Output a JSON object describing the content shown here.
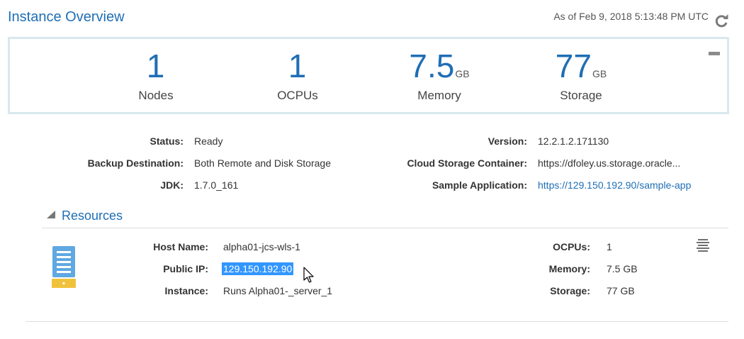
{
  "header": {
    "title": "Instance Overview",
    "as_of": "As of Feb 9, 2018 5:13:48 PM UTC",
    "refresh_icon": "refresh-icon"
  },
  "summary": {
    "nodes": {
      "value": "1",
      "unit": "",
      "label": "Nodes"
    },
    "ocpus": {
      "value": "1",
      "unit": "",
      "label": "OCPUs"
    },
    "memory": {
      "value": "7.5",
      "unit": "GB",
      "label": "Memory"
    },
    "storage": {
      "value": "77",
      "unit": "GB",
      "label": "Storage"
    },
    "collapse_icon": "minus-icon"
  },
  "details": {
    "status": {
      "label": "Status:",
      "value": "Ready"
    },
    "backup_destination": {
      "label": "Backup Destination:",
      "value": "Both Remote and Disk Storage"
    },
    "jdk": {
      "label": "JDK:",
      "value": "1.7.0_161"
    },
    "version": {
      "label": "Version:",
      "value": "12.2.1.2.171130"
    },
    "cloud_storage_container": {
      "label": "Cloud Storage Container:",
      "value": "https://dfoley.us.storage.oracle..."
    },
    "sample_application": {
      "label": "Sample Application:",
      "value": "https://129.150.192.90/sample-app"
    }
  },
  "resources": {
    "title": "Resources",
    "expand_icon": "triangle-icon",
    "node_icon": "server-icon",
    "menu_icon": "hamburger-menu-icon",
    "host_name": {
      "label": "Host Name:",
      "value": "alpha01-jcs-wls-1"
    },
    "public_ip": {
      "label": "Public IP:",
      "value": "129.150.192.90"
    },
    "instance": {
      "label": "Instance:",
      "value": "Runs Alpha01-_server_1"
    },
    "ocpus": {
      "label": "OCPUs:",
      "value": "1"
    },
    "memory": {
      "label": "Memory:",
      "value": "7.5 GB"
    },
    "storage": {
      "label": "Storage:",
      "value": "77 GB"
    }
  },
  "colors": {
    "accent": "#1f6eb5",
    "box_border": "#d9e8ef",
    "selection": "#3296ff",
    "server_icon_blue": "#5fa8e2",
    "server_icon_yellow": "#f0c23c"
  }
}
